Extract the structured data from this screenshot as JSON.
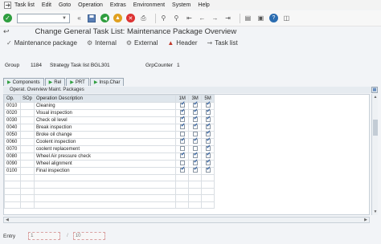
{
  "menu": [
    "Task list",
    "Edit",
    "Goto",
    "Operation",
    "Extras",
    "Environment",
    "System",
    "Help"
  ],
  "title": "Change General Task List: Maintenance Package Overview",
  "app_toolbar": [
    {
      "label": "Maintenance package",
      "icon": "package-icon"
    },
    {
      "label": "Internal",
      "icon": "internal-icon"
    },
    {
      "label": "External",
      "icon": "external-icon"
    },
    {
      "label": "Header",
      "icon": "header-icon"
    },
    {
      "label": "Task list",
      "icon": "task-list-icon"
    }
  ],
  "header": {
    "group_label": "Group",
    "group_value": "1184",
    "strategy_label": "Strategy Task list BGL301",
    "counter_label": "GrpCounter",
    "counter_value": "1"
  },
  "tabs": [
    {
      "label": "Components"
    },
    {
      "label": "Rel"
    },
    {
      "label": "PRT"
    },
    {
      "label": "Insp.Char"
    }
  ],
  "panel_title": "Operat. Overview Maint. Packages",
  "columns": {
    "op": "Op.",
    "sop": "SOp",
    "desc": "Operation Description",
    "m1": "1M",
    "m3": "3M",
    "m5": "5M"
  },
  "rows": [
    {
      "op": "0010",
      "desc": "Cleaning",
      "m1": true,
      "m3": true,
      "m5": true
    },
    {
      "op": "0020",
      "desc": "Visual inspection",
      "m1": true,
      "m3": true,
      "m5": true
    },
    {
      "op": "0030",
      "desc": "Check oil level",
      "m1": true,
      "m3": true,
      "m5": true
    },
    {
      "op": "0040",
      "desc": "Break inspection",
      "m1": true,
      "m3": true,
      "m5": true
    },
    {
      "op": "0050",
      "desc": "Broke oil change",
      "m1": false,
      "m3": false,
      "m5": true
    },
    {
      "op": "0060",
      "desc": "Coolent inspection",
      "m1": true,
      "m3": true,
      "m5": true
    },
    {
      "op": "0070",
      "desc": "coolent replacement",
      "m1": false,
      "m3": false,
      "m5": true
    },
    {
      "op": "0080",
      "desc": "Wheel Air pressure check",
      "m1": true,
      "m3": true,
      "m5": true
    },
    {
      "op": "0090",
      "desc": "Wheel alignment",
      "m1": false,
      "m3": true,
      "m5": true
    },
    {
      "op": "0100",
      "desc": "Final inspection",
      "m1": true,
      "m3": true,
      "m5": true
    }
  ],
  "empty_rows": 5,
  "footer": {
    "entry_label": "Entry",
    "entry_value": "1",
    "total_value": "10"
  }
}
